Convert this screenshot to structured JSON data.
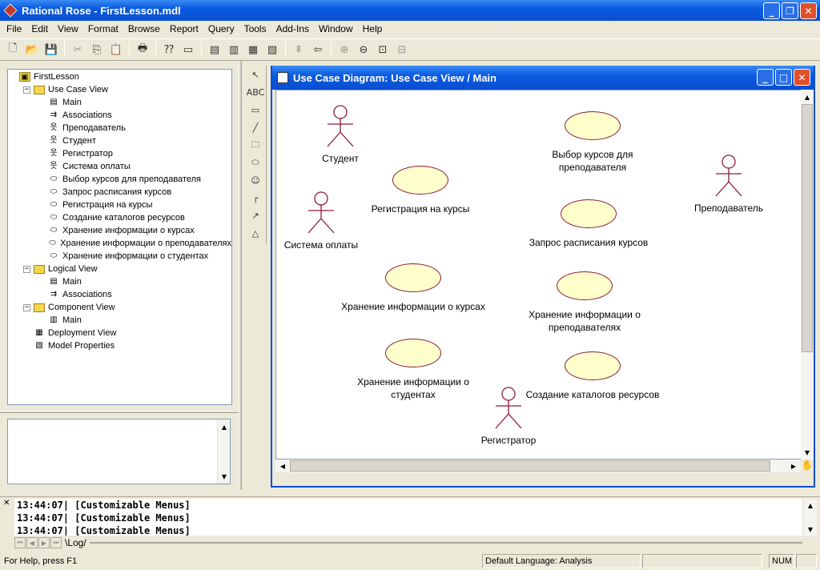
{
  "window": {
    "title": "Rational Rose - FirstLesson.mdl",
    "min": "_",
    "max": "❐",
    "close": "✕"
  },
  "menu": [
    "File",
    "Edit",
    "View",
    "Format",
    "Browse",
    "Report",
    "Query",
    "Tools",
    "Add-Ins",
    "Window",
    "Help"
  ],
  "toolbar": [
    {
      "icon": "new-file-icon",
      "glyph": "🗋"
    },
    {
      "icon": "open-icon",
      "glyph": "📂"
    },
    {
      "icon": "save-icon",
      "glyph": "💾"
    },
    {
      "sep": true
    },
    {
      "icon": "cut-icon",
      "glyph": "✂",
      "dim": true
    },
    {
      "icon": "copy-icon",
      "glyph": "⎘"
    },
    {
      "icon": "paste-icon",
      "glyph": "📋",
      "dim": true
    },
    {
      "sep": true
    },
    {
      "icon": "print-icon",
      "glyph": "🖶"
    },
    {
      "sep": true
    },
    {
      "icon": "context-help-icon",
      "glyph": "⁇"
    },
    {
      "icon": "view-doc-icon",
      "glyph": "▭"
    },
    {
      "sep": true
    },
    {
      "icon": "browse-class-diagram-icon",
      "glyph": "▤"
    },
    {
      "icon": "browse-interaction-diagram-icon",
      "glyph": "▥"
    },
    {
      "icon": "browse-component-diagram-icon",
      "glyph": "▦"
    },
    {
      "icon": "browse-deployment-diagram-icon",
      "glyph": "▧"
    },
    {
      "sep": true
    },
    {
      "icon": "browse-parent-icon",
      "glyph": "⇞",
      "dim": true
    },
    {
      "icon": "browse-previous-icon",
      "glyph": "⇦"
    },
    {
      "sep": true
    },
    {
      "icon": "zoom-in-icon",
      "glyph": "⊕",
      "dim": true
    },
    {
      "icon": "zoom-out-icon",
      "glyph": "⊖"
    },
    {
      "icon": "fit-window-icon",
      "glyph": "⊡"
    },
    {
      "icon": "undo-fit-icon",
      "glyph": "⊟",
      "dim": true
    }
  ],
  "tree": [
    {
      "label": "FirstLesson",
      "level": 0,
      "icon": "model",
      "exp": ""
    },
    {
      "label": "Use Case View",
      "level": 1,
      "icon": "folder",
      "exp": "−"
    },
    {
      "label": "Main",
      "level": 2,
      "icon": "diagram"
    },
    {
      "label": "Associations",
      "level": 2,
      "icon": "assoc"
    },
    {
      "label": "Преподаватель",
      "level": 2,
      "icon": "actor"
    },
    {
      "label": "Студент",
      "level": 2,
      "icon": "actor"
    },
    {
      "label": "Регистратор",
      "level": 2,
      "icon": "actor"
    },
    {
      "label": "Система оплаты",
      "level": 2,
      "icon": "actor"
    },
    {
      "label": " Выбор курсов для преподавателя",
      "level": 2,
      "icon": "usecase"
    },
    {
      "label": "Запрос расписания курсов",
      "level": 2,
      "icon": "usecase"
    },
    {
      "label": "Регистрация на курсы",
      "level": 2,
      "icon": "usecase"
    },
    {
      "label": "Создание каталогов ресурсов",
      "level": 2,
      "icon": "usecase"
    },
    {
      "label": "Хранение информации о курсах",
      "level": 2,
      "icon": "usecase"
    },
    {
      "label": "Хранение информации о преподавателях",
      "level": 2,
      "icon": "usecase"
    },
    {
      "label": "Хранение информации о студентах",
      "level": 2,
      "icon": "usecase"
    },
    {
      "label": "Logical View",
      "level": 1,
      "icon": "folder",
      "exp": "−"
    },
    {
      "label": "Main",
      "level": 2,
      "icon": "diagram"
    },
    {
      "label": "Associations",
      "level": 2,
      "icon": "assoc"
    },
    {
      "label": "Component View",
      "level": 1,
      "icon": "folder",
      "exp": "−"
    },
    {
      "label": "Main",
      "level": 2,
      "icon": "compdiag"
    },
    {
      "label": "Deployment View",
      "level": 1,
      "icon": "deploy"
    },
    {
      "label": "Model Properties",
      "level": 1,
      "icon": "props"
    }
  ],
  "palette": [
    {
      "icon": "selection-arrow-icon",
      "glyph": "↖"
    },
    {
      "icon": "text-box-icon",
      "glyph": "ABC"
    },
    {
      "icon": "note-icon",
      "glyph": "▭"
    },
    {
      "icon": "anchor-note-icon",
      "glyph": "╱"
    },
    {
      "icon": "package-icon",
      "glyph": "🗀"
    },
    {
      "icon": "use-case-tool-icon",
      "glyph": "⬭"
    },
    {
      "icon": "actor-tool-icon",
      "glyph": "☺"
    },
    {
      "icon": "unidirectional-association-icon",
      "glyph": "┌"
    },
    {
      "icon": "dependency-icon",
      "glyph": "↗"
    },
    {
      "icon": "generalization-icon",
      "glyph": "△"
    }
  ],
  "diagram": {
    "title": "Use Case Diagram: Use Case View / Main",
    "actors": [
      {
        "name": "Студент",
        "key": "student"
      },
      {
        "name": "Система оплаты",
        "key": "payment"
      },
      {
        "name": "Преподаватель",
        "key": "teacher"
      },
      {
        "name": "Регистратор",
        "key": "registrar"
      }
    ],
    "usecases": [
      {
        "lines": [
          "Выбор курсов для",
          "преподавателя"
        ],
        "key": "choose"
      },
      {
        "lines": [
          "Регистрация на курсы"
        ],
        "key": "register"
      },
      {
        "lines": [
          "Запрос расписания курсов"
        ],
        "key": "schedule"
      },
      {
        "lines": [
          "Хранение информации о курсах"
        ],
        "key": "courses"
      },
      {
        "lines": [
          "Хранение информации о",
          "преподавателях"
        ],
        "key": "teachers"
      },
      {
        "lines": [
          "Хранение информации о",
          "студентах"
        ],
        "key": "students"
      },
      {
        "lines": [
          "Создание каталогов ресурсов"
        ],
        "key": "catalog"
      }
    ]
  },
  "log": {
    "lines": [
      "13:44:07|  [Customizable Menus]",
      "13:44:07|  [Customizable Menus]",
      "13:44:07|  [Customizable Menus]"
    ],
    "tab": "\\Log/"
  },
  "status": {
    "help": "For Help, press F1",
    "language": "Default Language: Analysis",
    "num": "NUM"
  }
}
